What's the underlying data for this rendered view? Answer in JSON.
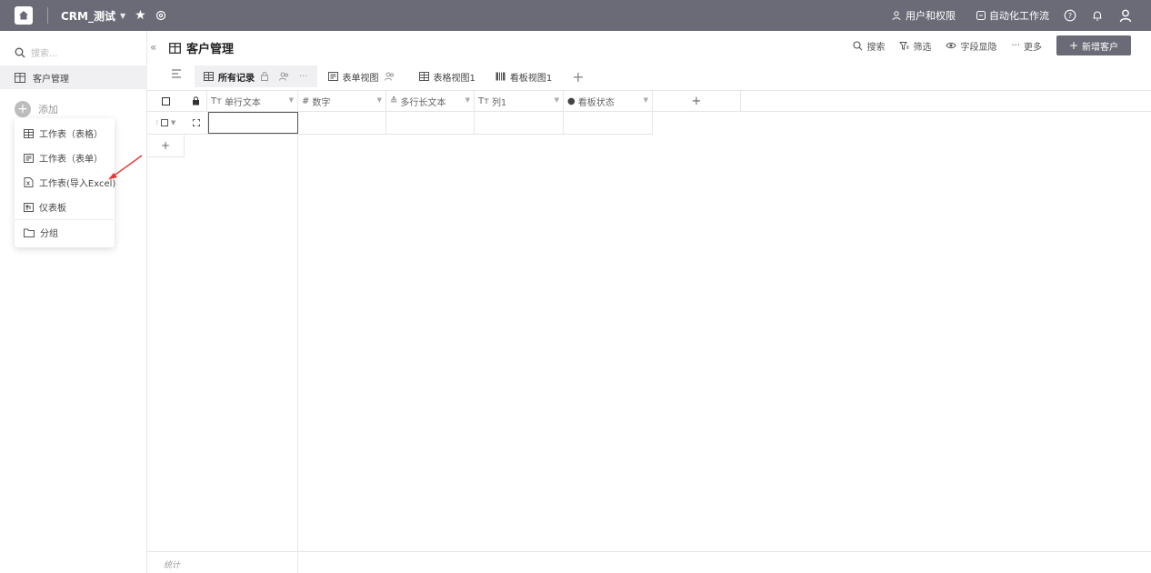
{
  "topbar": {
    "app_name": "CRM_测试",
    "links": {
      "users_permissions": "用户和权限",
      "automation": "自动化工作流"
    }
  },
  "sidebar": {
    "search_placeholder": "搜索...",
    "items": [
      {
        "label": "客户管理",
        "icon": "table-icon"
      }
    ],
    "add_label": "添加"
  },
  "add_menu": {
    "items": [
      {
        "label": "工作表（表格）",
        "icon": "table-icon"
      },
      {
        "label": "工作表（表单）",
        "icon": "form-icon"
      },
      {
        "label": "工作表(导入Excel)",
        "icon": "excel-import-icon"
      },
      {
        "label": "仪表板",
        "icon": "dashboard-icon"
      },
      {
        "label": "分组",
        "icon": "folder-icon"
      }
    ]
  },
  "main": {
    "title": "客户管理",
    "actions": {
      "search": "搜索",
      "filter": "筛选",
      "fields": "字段显隐",
      "more": "更多",
      "new_button": "新增客户"
    },
    "tabs": [
      {
        "label": "所有记录",
        "active": true
      },
      {
        "label": "表单视图"
      },
      {
        "label": "表格视图1"
      },
      {
        "label": "看板视图1"
      }
    ],
    "columns": [
      {
        "prefix": "Tт",
        "label": "单行文本"
      },
      {
        "prefix": "#",
        "label": "数字"
      },
      {
        "prefix": "≙",
        "label": "多行长文本"
      },
      {
        "prefix": "Tт",
        "label": "列1"
      },
      {
        "prefix": "●",
        "label": "看板状态"
      }
    ],
    "footer_label": "统计"
  },
  "colors": {
    "topbar": "#6b6b77",
    "sidebar_active": "#f0f0f3",
    "annotation_arrow": "#e53935"
  }
}
